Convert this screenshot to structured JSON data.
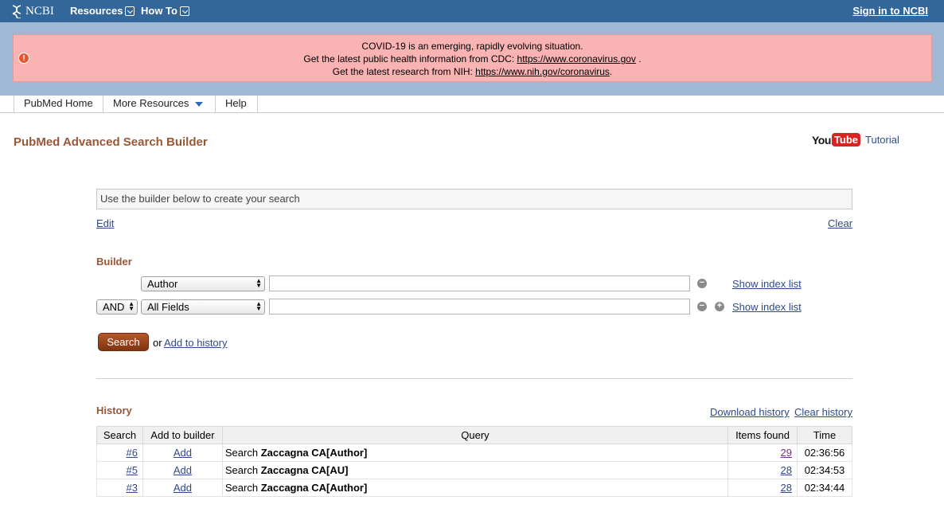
{
  "topbar": {
    "logo_text": "NCBI",
    "resources_label": "Resources",
    "howto_label": "How To",
    "signin_label": "Sign in to NCBI"
  },
  "banner": {
    "line1": "COVID-19 is an emerging, rapidly evolving situation.",
    "line2_prefix": "Get the latest public health information from CDC: ",
    "line2_link": "https://www.coronavirus.gov",
    "line2_suffix": " .",
    "line3_prefix": "Get the latest research from NIH: ",
    "line3_link": "https://www.nih.gov/coronavirus",
    "line3_suffix": "."
  },
  "nav": {
    "tabs": [
      {
        "label": "PubMed Home"
      },
      {
        "label": "More Resources"
      },
      {
        "label": "Help"
      }
    ]
  },
  "page": {
    "title": "PubMed Advanced Search Builder",
    "tutorial_you": "You",
    "tutorial_tube": "Tube",
    "tutorial_label": "Tutorial"
  },
  "query": {
    "placeholder": "Use the builder below to create your search",
    "edit_label": "Edit",
    "clear_label": "Clear"
  },
  "builder": {
    "heading": "Builder",
    "rows": [
      {
        "operator": "",
        "field": "Author",
        "value": "",
        "show_index": "Show index list"
      },
      {
        "operator": "AND",
        "field": "All Fields",
        "value": "",
        "show_index": "Show index list"
      }
    ],
    "search_label": "Search",
    "or_text": "or",
    "add_history_label": "Add to history"
  },
  "history": {
    "heading": "History",
    "download_label": "Download history",
    "clear_label": "Clear history",
    "columns": [
      "Search",
      "Add to builder",
      "Query",
      "Items found",
      "Time"
    ],
    "rows": [
      {
        "search": "#6",
        "add": "Add",
        "query_prefix": "Search ",
        "query_term": "Zaccagna CA[Author]",
        "items": "29",
        "time": "02:36:56"
      },
      {
        "search": "#5",
        "add": "Add",
        "query_prefix": "Search ",
        "query_term": "Zaccagna CA[AU]",
        "items": "28",
        "time": "02:34:53"
      },
      {
        "search": "#3",
        "add": "Add",
        "query_prefix": "Search ",
        "query_term": "Zaccagna CA[Author]",
        "items": "28",
        "time": "02:34:44"
      }
    ]
  },
  "colors": {
    "topbar": "#336699",
    "banner_bg": "#f9b3b3",
    "title": "#985735",
    "search_button": "#9a4318"
  }
}
